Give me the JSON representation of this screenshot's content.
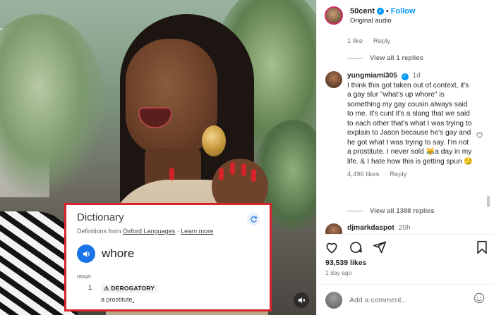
{
  "media": {
    "dictionary": {
      "title": "Dictionary",
      "source_prefix": "Definitions from",
      "source_link": "Oxford Languages",
      "source_sep": "·",
      "learn_more": "Learn more",
      "word": "whore",
      "part_of_speech": "noun",
      "definition_number": "1.",
      "definition_tag": "⚠ DEROGATORY",
      "definition_prefix": "a",
      "definition_link": "prostitute",
      "definition_suffix": ".",
      "icons": [
        "refresh-icon",
        "speaker-icon"
      ]
    },
    "mute_icon": "muted-speaker-icon"
  },
  "post_header": {
    "username": "50cent",
    "separator": "•",
    "follow_label": "Follow",
    "audio_label": "Original audio"
  },
  "comments": {
    "prev_actions": {
      "likes": "1 like",
      "reply": "Reply"
    },
    "view_replies_1": "View all 1 replies",
    "main_comment": {
      "username": "yungmiami305",
      "time": "1d",
      "text": "I think this got taken out of context, it's a gay slur \"what's up whore\" is something my gay cousin always said to me. It's cunt it's a slang that we said to each other that's what I was trying to explain to Jason because he's gay and he got what I was trying to say. I'm not a prostitute. I never sold 😹a day in my life. & I hate how this is getting spun 😏",
      "likes": "4,496 likes",
      "reply": "Reply"
    },
    "view_replies_2": "View all 1388 replies",
    "next_comment": {
      "username": "djmarkdaspot",
      "time": "20h"
    }
  },
  "actions": {
    "likes": "93,539 likes",
    "time_ago": "1 day ago",
    "icons": [
      "heart-icon",
      "comment-icon",
      "share-icon",
      "bookmark-icon"
    ]
  },
  "add_comment": {
    "placeholder": "Add a comment...",
    "emoji_icon": "emoji-icon"
  },
  "colors": {
    "link_blue": "#0095f6",
    "verified_blue": "#0095f6",
    "dictionary_border": "#d7242a",
    "speaker_blue": "#1a73e8"
  }
}
